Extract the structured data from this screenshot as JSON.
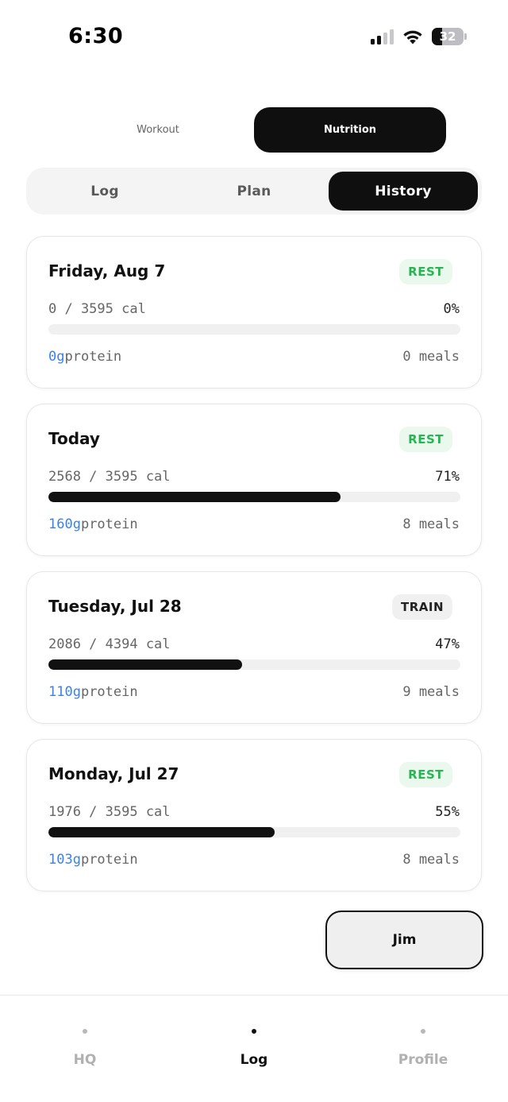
{
  "status_bar": {
    "time": "6:30",
    "battery": "32",
    "battery_level": 0.32,
    "icons": [
      "cellular-signal-icon",
      "wifi-icon",
      "battery-icon"
    ]
  },
  "main_toggle": {
    "options": [
      {
        "label": "Workout",
        "active": false
      },
      {
        "label": "Nutrition",
        "active": true
      }
    ]
  },
  "sub_tabs": [
    {
      "label": "Log",
      "active": false
    },
    {
      "label": "Plan",
      "active": false
    },
    {
      "label": "History",
      "active": true
    }
  ],
  "history": [
    {
      "title": "Friday, Aug 7",
      "badge": "REST",
      "calories": "0 / 3595 cal",
      "percent": "0%",
      "progress": 0.0,
      "protein_value": "0g",
      "protein_label": "protein",
      "meals": "0 meals"
    },
    {
      "title": "Today",
      "badge": "REST",
      "calories": "2568 / 3595 cal",
      "percent": "71%",
      "progress": 0.71,
      "protein_value": "160g",
      "protein_label": "protein",
      "meals": "8 meals"
    },
    {
      "title": "Tuesday, Jul 28",
      "badge": "TRAIN",
      "calories": "2086 / 4394 cal",
      "percent": "47%",
      "progress": 0.47,
      "protein_value": "110g",
      "protein_label": "protein",
      "meals": "9 meals"
    },
    {
      "title": "Monday, Jul 27",
      "badge": "REST",
      "calories": "1976 / 3595 cal",
      "percent": "55%",
      "progress": 0.55,
      "protein_value": "103g",
      "protein_label": "protein",
      "meals": "8 meals"
    }
  ],
  "jim_button": {
    "label": "Jim"
  },
  "bottom_nav": [
    {
      "label": "HQ",
      "active": false
    },
    {
      "label": "Log",
      "active": true
    },
    {
      "label": "Profile",
      "active": false
    }
  ],
  "colors": {
    "rest_badge": "#26b553",
    "rest_badge_bg": "#eaf8ee",
    "protein": "#3b82e6",
    "active_bg": "#0f0f0f"
  }
}
